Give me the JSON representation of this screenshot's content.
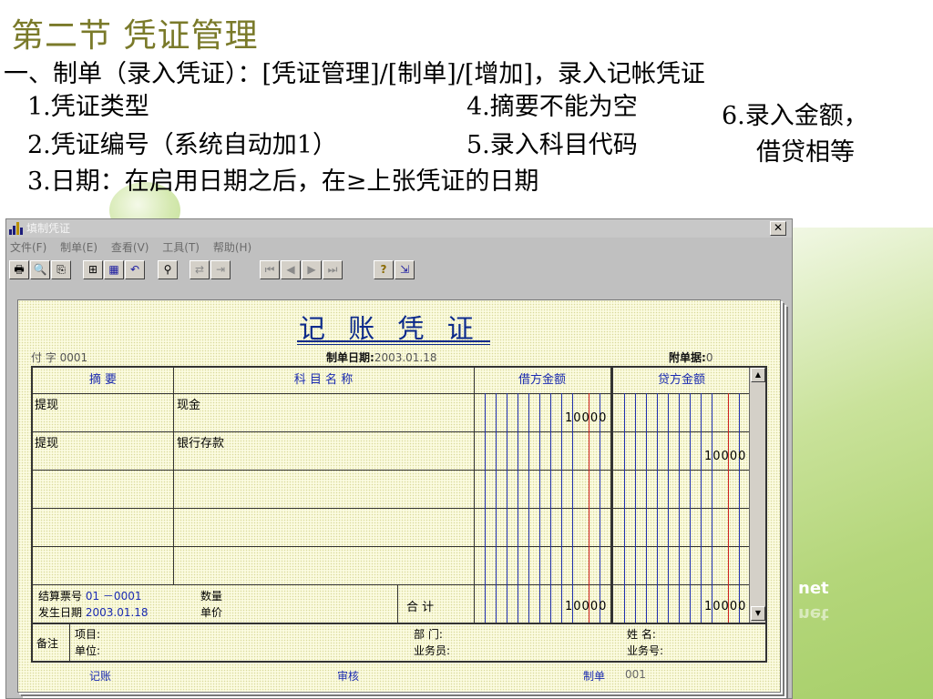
{
  "slide": {
    "title": "第二节 凭证管理",
    "line1": "一、制单（录入凭证）：[凭证管理]/[制单]/[增加]，录入记帐凭证",
    "item1": "1.凭证类型",
    "item2": "2.凭证编号（系统自动加1）",
    "item3": "3.日期：在启用日期之后，在≥上张凭证的日期",
    "item4": "4.摘要不能为空",
    "item5": "5.录入科目代码",
    "item6a": "6.录入金额，",
    "item6b": "借贷相等",
    "deco": "net"
  },
  "window": {
    "title": "填制凭证",
    "close": "✕",
    "menu": [
      "文件(F)",
      "制单(E)",
      "查看(V)",
      "工具(T)",
      "帮助(H)"
    ],
    "toolbar": [
      {
        "glyph": "🖶",
        "icon": "print-icon"
      },
      {
        "glyph": "🔍",
        "icon": "preview-icon"
      },
      {
        "glyph": "⎘",
        "icon": "output-icon"
      },
      {
        "glyph": "⊞",
        "icon": "add-icon"
      },
      {
        "glyph": "▦",
        "icon": "save-icon"
      },
      {
        "glyph": "↶",
        "icon": "undo-icon"
      },
      {
        "glyph": "⚲",
        "icon": "find-icon"
      },
      {
        "glyph": "⇄",
        "icon": "insert-row-icon"
      },
      {
        "glyph": "⇥",
        "icon": "delete-row-icon"
      },
      {
        "glyph": "⏮",
        "icon": "first-icon"
      },
      {
        "glyph": "◀",
        "icon": "prev-icon"
      },
      {
        "glyph": "▶",
        "icon": "next-icon"
      },
      {
        "glyph": "⏭",
        "icon": "last-icon"
      },
      {
        "glyph": "?",
        "icon": "help-icon"
      },
      {
        "glyph": "⇲",
        "icon": "exit-icon"
      }
    ]
  },
  "voucher": {
    "title": "记 账 凭 证",
    "type_label": "付 字",
    "number": "0001",
    "date_label": "制单日期:",
    "date": "2003.01.18",
    "attach_label": "附单据:",
    "attach": "0",
    "headers": {
      "summary": "摘  要",
      "account": "科 目 名 称",
      "debit": "借方金额",
      "credit": "贷方金额"
    },
    "rows": [
      {
        "summary": "提现",
        "account": "现金",
        "debit": "10000",
        "credit": ""
      },
      {
        "summary": "提现",
        "account": "银行存款",
        "debit": "",
        "credit": "10000"
      }
    ],
    "settle_label": "结算票号",
    "settle_value": "01 －0001",
    "occur_label": "发生日期",
    "occur_value": "2003.01.18",
    "qty_label": "数量",
    "price_label": "单价",
    "total_label": "合  计",
    "total_debit": "10000",
    "total_credit": "10000",
    "remark_label": "备注",
    "project_label": "项目:",
    "unit_label": "单位:",
    "dept_label": "部  门:",
    "staff_label": "业务员:",
    "name_label": "姓  名:",
    "bizno_label": "业务号:",
    "footer": {
      "post": "记账",
      "audit": "审核",
      "maker": "制单",
      "maker_value": "001"
    }
  }
}
